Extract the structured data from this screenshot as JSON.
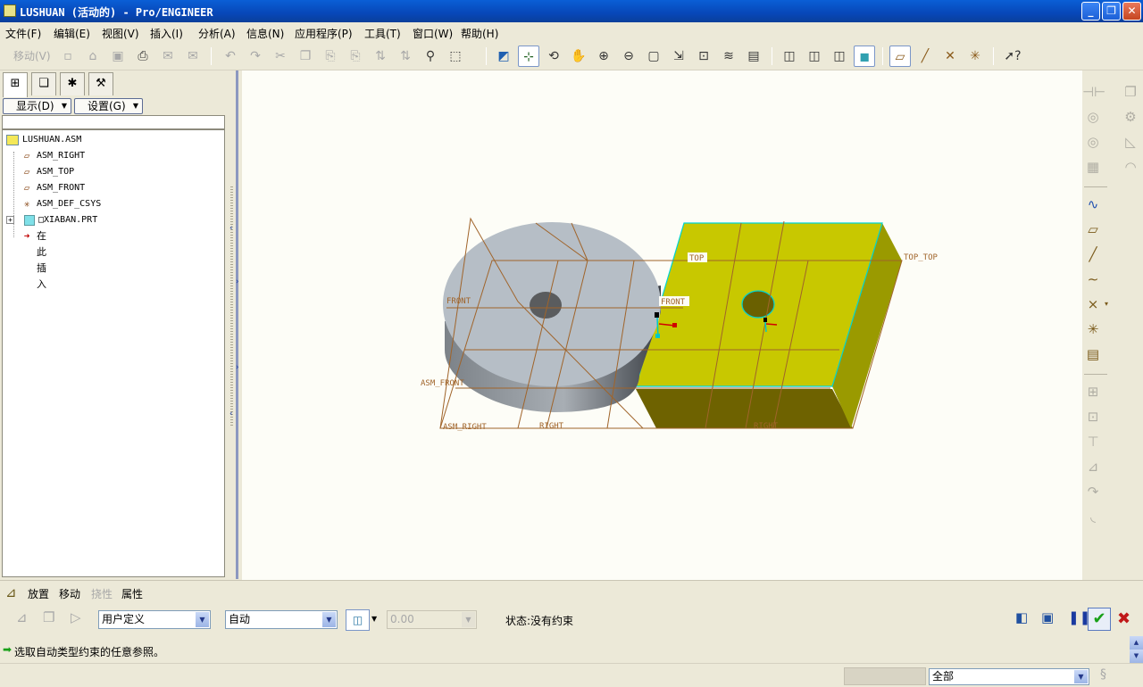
{
  "window": {
    "title": "LUSHUAN (活动的) - Pro/ENGINEER",
    "buttons": [
      "_",
      "❐",
      "✕"
    ]
  },
  "menu": [
    "文件(F)",
    "编辑(E)",
    "视图(V)",
    "插入(I)",
    "分析(A)",
    "信息(N)",
    "应用程序(P)",
    "工具(T)",
    "窗口(W)",
    "帮助(H)"
  ],
  "toolbar": {
    "move_label": "移动(V)"
  },
  "navigator": {
    "tabs": [
      "model-tree",
      "folder-browser",
      "favorites",
      "connections"
    ],
    "show_label": "显示(D)",
    "settings_label": "设置(G)",
    "tree": [
      {
        "label": "LUSHUAN.ASM",
        "icon": "assembly-icon"
      },
      {
        "label": "ASM_RIGHT",
        "icon": "datum-plane-icon"
      },
      {
        "label": "ASM_TOP",
        "icon": "datum-plane-icon"
      },
      {
        "label": "ASM_FRONT",
        "icon": "datum-plane-icon"
      },
      {
        "label": "ASM_DEF_CSYS",
        "icon": "csys-icon"
      },
      {
        "label": "□XIABAN.PRT",
        "icon": "part-icon"
      },
      {
        "label": "在此插入",
        "icon": "insert-here-arrow-icon"
      }
    ]
  },
  "viewport": {
    "labels": {
      "top": "TOP",
      "top_top": "TOP_TOP",
      "front_left": "FRONT",
      "front_right": "FRONT",
      "asm_front": "ASM_FRONT",
      "asm_right": "ASM_RIGHT",
      "right_left": "RIGHT",
      "right_right": "RIGHT"
    },
    "colors": {
      "background": "#fdfdf7",
      "datum": "#a0642a",
      "block_face": "#c8c800",
      "cylinder": "#b4bcc4",
      "highlight": "#00e0e0"
    }
  },
  "dashboard": {
    "tabs": [
      "放置",
      "移动",
      "挠性",
      "属性"
    ],
    "constraint_set": "用户定义",
    "constraint_type": "自动",
    "offset_value": "0.00",
    "status": "状态:没有约束"
  },
  "message": "选取自动类型约束的任意参照。",
  "filter": "全部"
}
